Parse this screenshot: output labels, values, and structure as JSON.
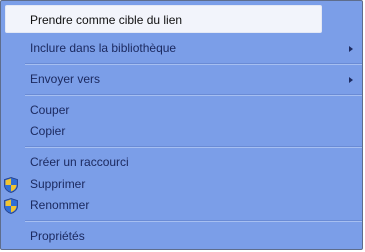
{
  "menu": {
    "items": [
      {
        "label": "Prendre comme cible du lien"
      },
      {
        "label": "Inclure dans la bibliothèque"
      },
      {
        "label": "Envoyer vers"
      },
      {
        "label": "Couper"
      },
      {
        "label": "Copier"
      },
      {
        "label": "Créer un raccourci"
      },
      {
        "label": "Supprimer"
      },
      {
        "label": "Renommer"
      },
      {
        "label": "Propriétés"
      }
    ]
  },
  "icons": {
    "submenu_arrow": "chevron-right-icon",
    "admin": "uac-shield-icon"
  },
  "colors": {
    "menu_background": "#7b9ee8",
    "highlight_background": "#f2f4fb",
    "text": "#1c2a60"
  }
}
